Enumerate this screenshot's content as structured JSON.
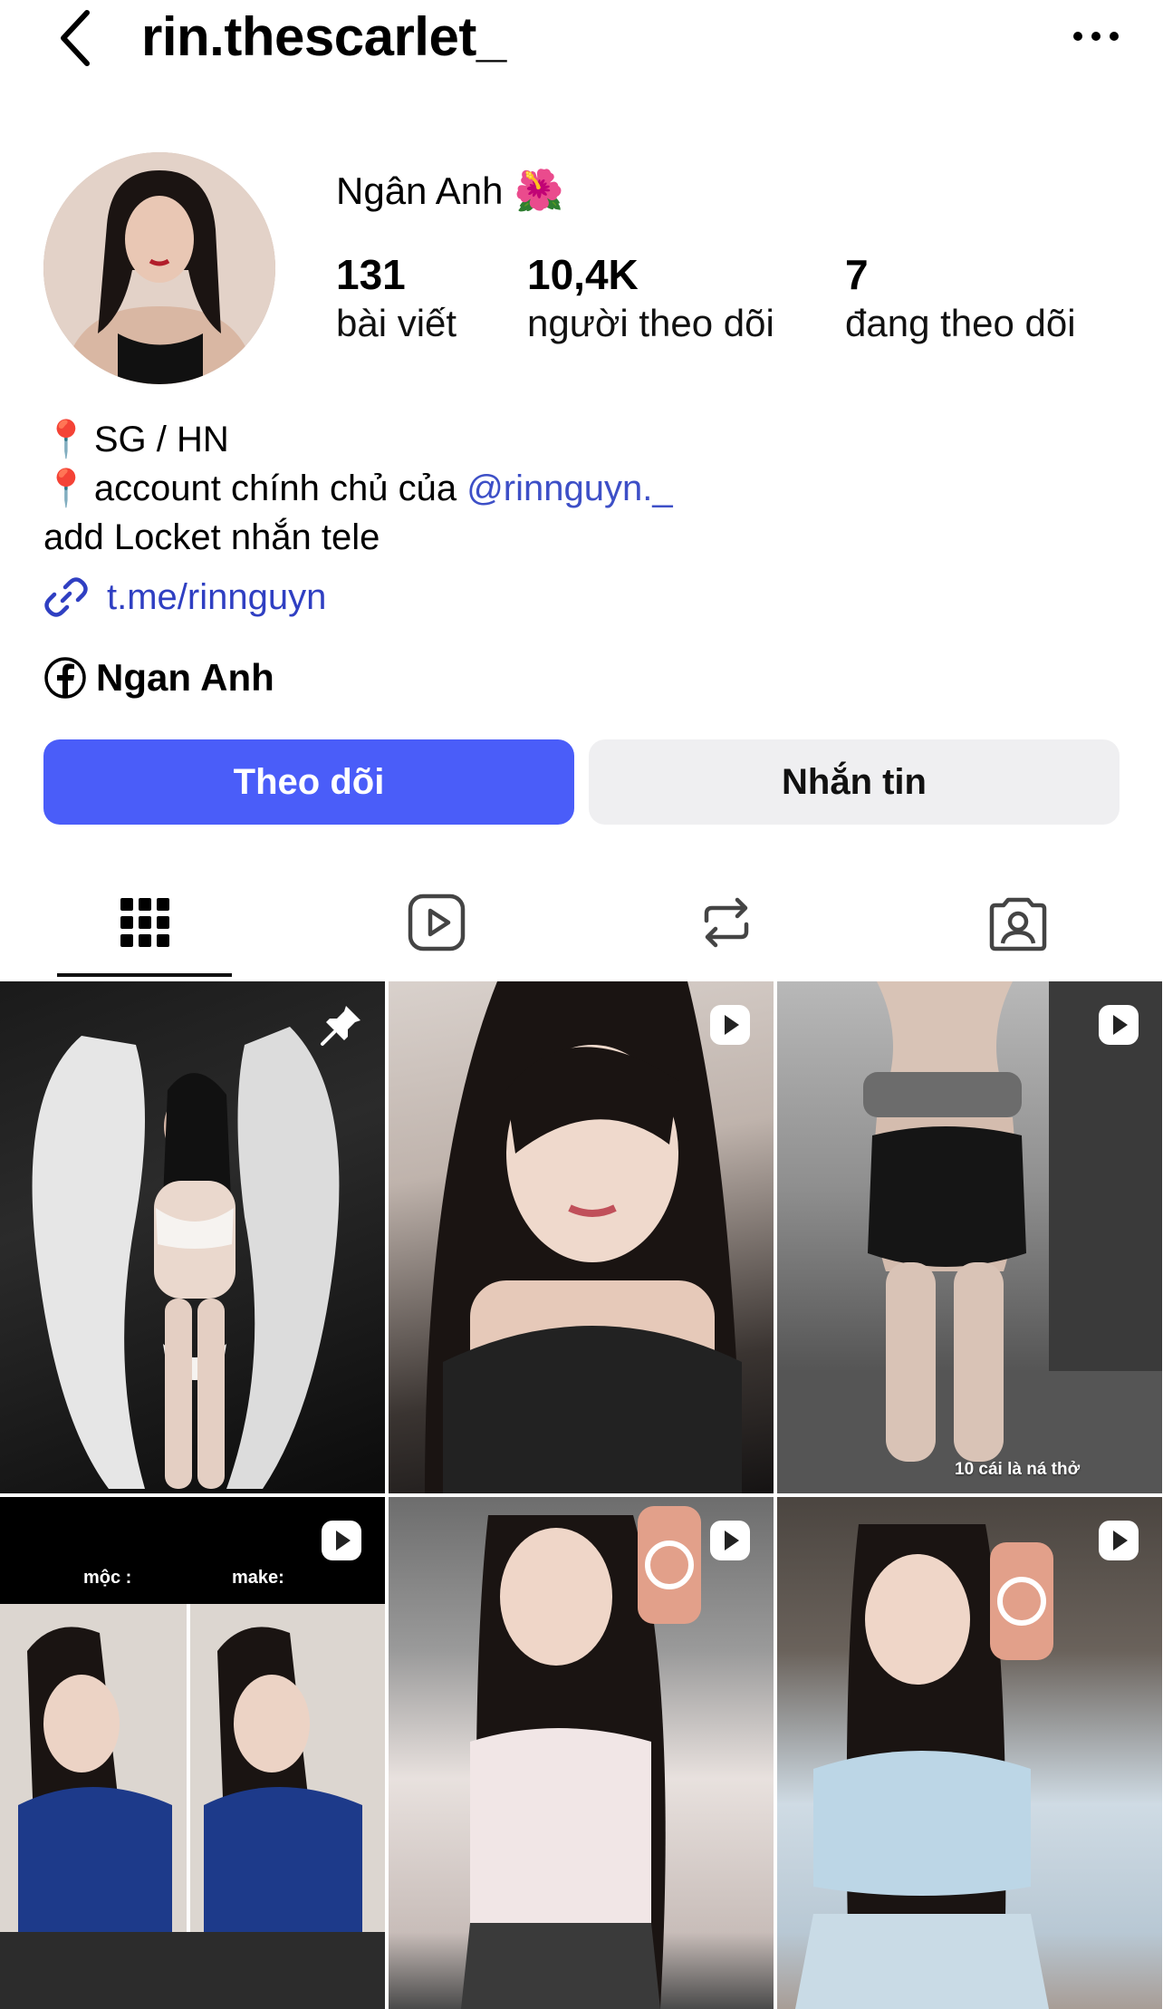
{
  "header": {
    "username": "rin.thescarlet_",
    "back_icon": "chevron-left-icon",
    "more_icon": "more-horizontal-icon"
  },
  "profile": {
    "display_name": "Ngân Anh",
    "name_emoji": "🌺",
    "stats": {
      "posts": {
        "value": "131",
        "label": "bài viết"
      },
      "followers": {
        "value": "10,4K",
        "label": "người theo dõi"
      },
      "following": {
        "value": "7",
        "label": "đang theo dõi"
      }
    }
  },
  "bio": {
    "line1": "SG / HN",
    "line2_prefix": "account chính chủ của ",
    "line2_mention": "@rinnguyn._",
    "line3": "add Locket nhắn tele",
    "pin_emoji": "📍"
  },
  "link": {
    "text": "t.me/rinnguyn"
  },
  "facebook": {
    "name": "Ngan Anh"
  },
  "actions": {
    "follow_label": "Theo dõi",
    "message_label": "Nhắn tin"
  },
  "tabs": [
    {
      "icon": "grid-icon",
      "active": true
    },
    {
      "icon": "reels-icon",
      "active": false
    },
    {
      "icon": "reposts-icon",
      "active": false
    },
    {
      "icon": "tagged-icon",
      "active": false
    }
  ],
  "posts": [
    {
      "badge": "pin-icon"
    },
    {
      "badge": "reel-icon"
    },
    {
      "badge": "reel-icon",
      "caption": "10 cái là ná thở"
    },
    {
      "badge": "reel-icon",
      "caption_left": "mộc :",
      "caption_right": "make:"
    },
    {
      "badge": "reel-icon"
    },
    {
      "badge": "reel-icon"
    }
  ],
  "colors": {
    "follow_button": "#4a5df9",
    "message_button": "#efeff1",
    "link": "#2f3fc2",
    "mention": "#3d4fc7"
  }
}
